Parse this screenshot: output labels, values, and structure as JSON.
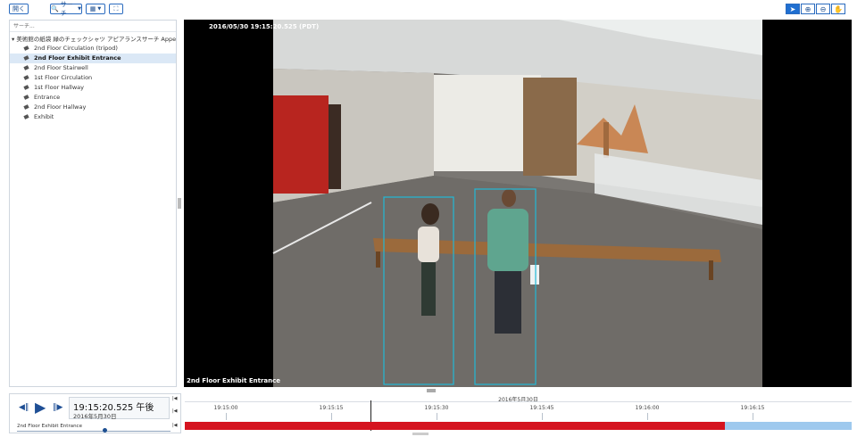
{
  "toolbar": {
    "open_label": "開く",
    "search_label": "サーチ",
    "layout_icon": "grid-layout-icon",
    "fullscreen_icon": "fullscreen-icon",
    "right_tools": [
      "pointer-icon",
      "zoom-in-icon",
      "zoom-out-icon",
      "pan-hand-icon"
    ]
  },
  "sidebar": {
    "search_placeholder": "サーチ...",
    "root_label": "美術館の紙袋 緑のチェックシャツ アピアランスサーチ Appea...",
    "items": [
      {
        "label": "2nd Floor Circulation (tripod)"
      },
      {
        "label": "2nd Floor Exhibit Entrance",
        "selected": true
      },
      {
        "label": "2nd Floor Stairwell"
      },
      {
        "label": "1st Floor Circulation"
      },
      {
        "label": "1st Floor Hallway"
      },
      {
        "label": "Entrance"
      },
      {
        "label": "2nd Floor Hallway"
      },
      {
        "label": "Exhibit"
      }
    ]
  },
  "video": {
    "timestamp": "2016/05/30 19:15:20.525 (PDT)",
    "camera_name": "2nd Floor Exhibit Entrance",
    "detection_color": "#22b8d6"
  },
  "player": {
    "time": "19:15:20.525 午後",
    "date": "2016年5月30日",
    "camera": "2nd Floor Exhibit Entrance",
    "speed_fraction": 0.56
  },
  "timeline": {
    "date_label": "2016年5月30日",
    "tick_labels": [
      "19:15:00",
      "19:15:15",
      "19:15:30",
      "19:15:45",
      "19:16:00",
      "19:16:15"
    ],
    "recording_color": "#d5131f",
    "motion_color": "#9ec9ee",
    "recorded_fraction": 0.81
  }
}
